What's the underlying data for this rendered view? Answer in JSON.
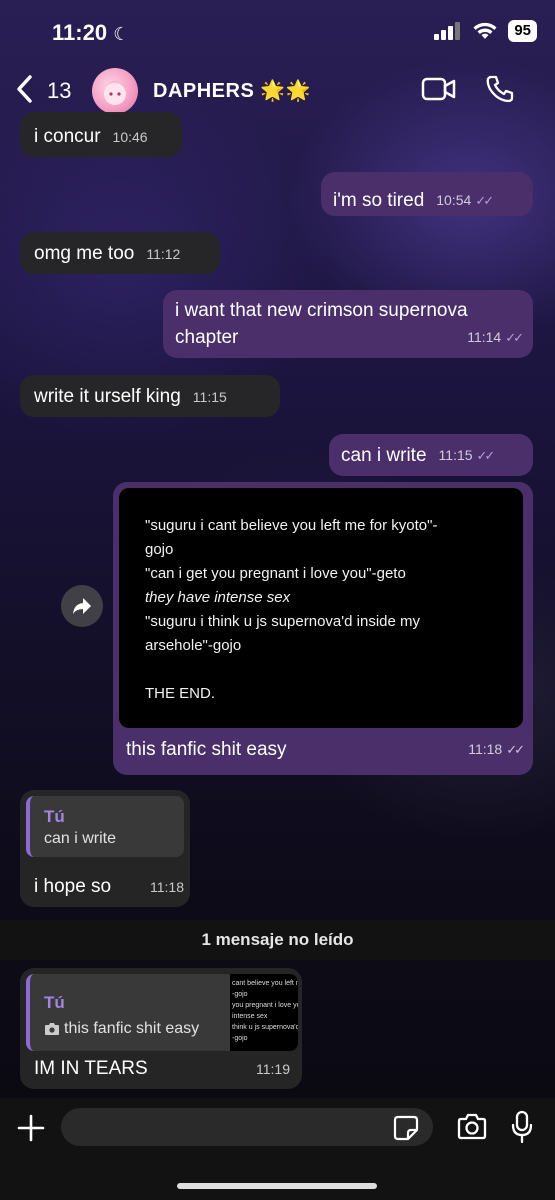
{
  "status_bar": {
    "time": "11:20",
    "battery": "95"
  },
  "header": {
    "back_count": "13",
    "title": "DAPHERS 🌟🌟"
  },
  "messages": [
    {
      "text": "i concur",
      "time": "10:46"
    },
    {
      "text": "i'm so tired",
      "time": "10:54"
    },
    {
      "text": "omg me too",
      "time": "11:12"
    },
    {
      "text": "i want that new crimson supernova",
      "text2": "chapter",
      "time": "11:14"
    },
    {
      "text": "write it urself king",
      "time": "11:15"
    },
    {
      "text": "can i write",
      "time": "11:15"
    },
    {
      "image_lines": [
        "\"suguru i cant believe you left me for kyoto\"-",
        "gojo",
        "\"can i get you pregnant i love you\"-geto",
        "they have intense sex",
        "\"suguru i think u js supernova'd inside my",
        "arsehole\"-gojo",
        "",
        "THE END."
      ],
      "text": "this fanfic shit easy",
      "time": "11:18"
    },
    {
      "quote_name": "Tú",
      "quote_text": "can i write",
      "text": "i hope so",
      "time": "11:18"
    },
    {
      "quote_name": "Tú",
      "quote_text": "this fanfic shit easy",
      "thumb_lines": [
        "cant believe you left me for kyo",
        "-gojo",
        "you pregnant i love you\"-getc",
        "intense sex",
        "think u js supernova'd inside",
        "-gojo"
      ],
      "text": "IM IN TEARS",
      "time": "11:19"
    }
  ],
  "unread_divider": "1 mensaje no leído",
  "composer": {
    "placeholder": ""
  },
  "colors": {
    "outgoing": "#4a2f6b",
    "incoming": "#262626",
    "accent": "#a585df"
  }
}
